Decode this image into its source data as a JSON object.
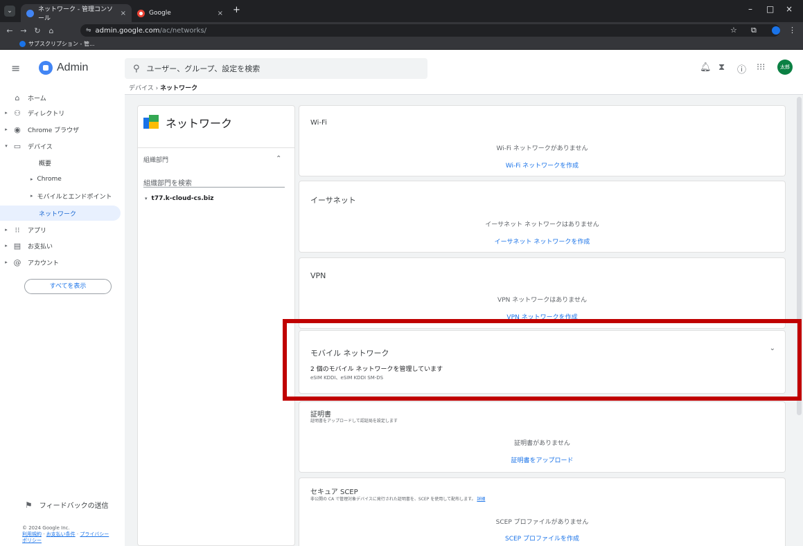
{
  "browser": {
    "tabs": [
      {
        "title": "ネットワーク - 管理コンソール",
        "active": true
      },
      {
        "title": "Google",
        "active": false
      }
    ],
    "new_tab": "+",
    "window_controls": {
      "minimize": "–",
      "maximize": "□",
      "close": "×"
    },
    "address": {
      "domain": "admin.google.com",
      "path": "/ac/networks/"
    },
    "bookmark": "サブスクリプション - 管..."
  },
  "header": {
    "app_name": "Admin",
    "search_placeholder": "ユーザー、グループ、設定を検索",
    "avatar_text": "太郎"
  },
  "breadcrumb": {
    "parent": "デバイス",
    "separator": "›",
    "current": "ネットワーク"
  },
  "sidebar": {
    "items": [
      {
        "label": "ホーム",
        "icon": "home-icon"
      },
      {
        "label": "ディレクトリ",
        "icon": "people-icon"
      },
      {
        "label": "Chrome ブラウザ",
        "icon": "chrome-icon"
      },
      {
        "label": "デバイス",
        "icon": "devices-icon"
      },
      {
        "label": "概要"
      },
      {
        "label": "Chrome"
      },
      {
        "label": "モバイルとエンドポイント"
      },
      {
        "label": "ネットワーク"
      },
      {
        "label": "アプリ",
        "icon": "apps-grid-icon"
      },
      {
        "label": "お支払い",
        "icon": "billing-icon"
      },
      {
        "label": "アカウント",
        "icon": "at-icon"
      }
    ],
    "show_all": "すべてを表示",
    "feedback": "フィードバックの送信",
    "copyright": "© 2024 Google Inc.",
    "legal_links": [
      "利用規約",
      "お支払い条件",
      "プライバシー",
      "ポリシー"
    ]
  },
  "org_panel": {
    "title": "ネットワーク",
    "section_label": "組織部門",
    "search_placeholder": "組織部門を検索",
    "root_org": "t77.k-cloud-cs.biz"
  },
  "cards": {
    "wifi": {
      "title": "Wi-Fi",
      "empty": "Wi-Fi ネットワークがありません",
      "action": "Wi-Fi ネットワークを作成"
    },
    "ethernet": {
      "title": "イーサネット",
      "empty": "イーサネット ネットワークはありません",
      "action": "イーサネット ネットワークを作成"
    },
    "vpn": {
      "title": "VPN",
      "empty": "VPN ネットワークはありません",
      "action": "VPN ネットワークを作成"
    },
    "mobile": {
      "title": "モバイル ネットワーク",
      "summary": "2 個のモバイル ネットワークを管理しています",
      "detail": "eSIM KDDI、eSIM KDDI SM-DS"
    },
    "certificates": {
      "title": "証明書",
      "subtitle": "証明書をアップロードして認証局を設定します",
      "empty": "証明書がありません",
      "action": "証明書をアップロード"
    },
    "scep": {
      "title": "セキュア SCEP",
      "subtitle": "非公開の CA で管理対象デバイスに発行された証明書を、SCEP を使用して配布します。",
      "subtitle_link": "詳細",
      "empty": "SCEP プロファイルがありません",
      "action": "SCEP プロファイルを作成"
    }
  },
  "colors": {
    "highlight": "#c00000",
    "link": "#1a73e8",
    "selected_bg": "#e8f0fe",
    "avatar": "#0b8043"
  }
}
